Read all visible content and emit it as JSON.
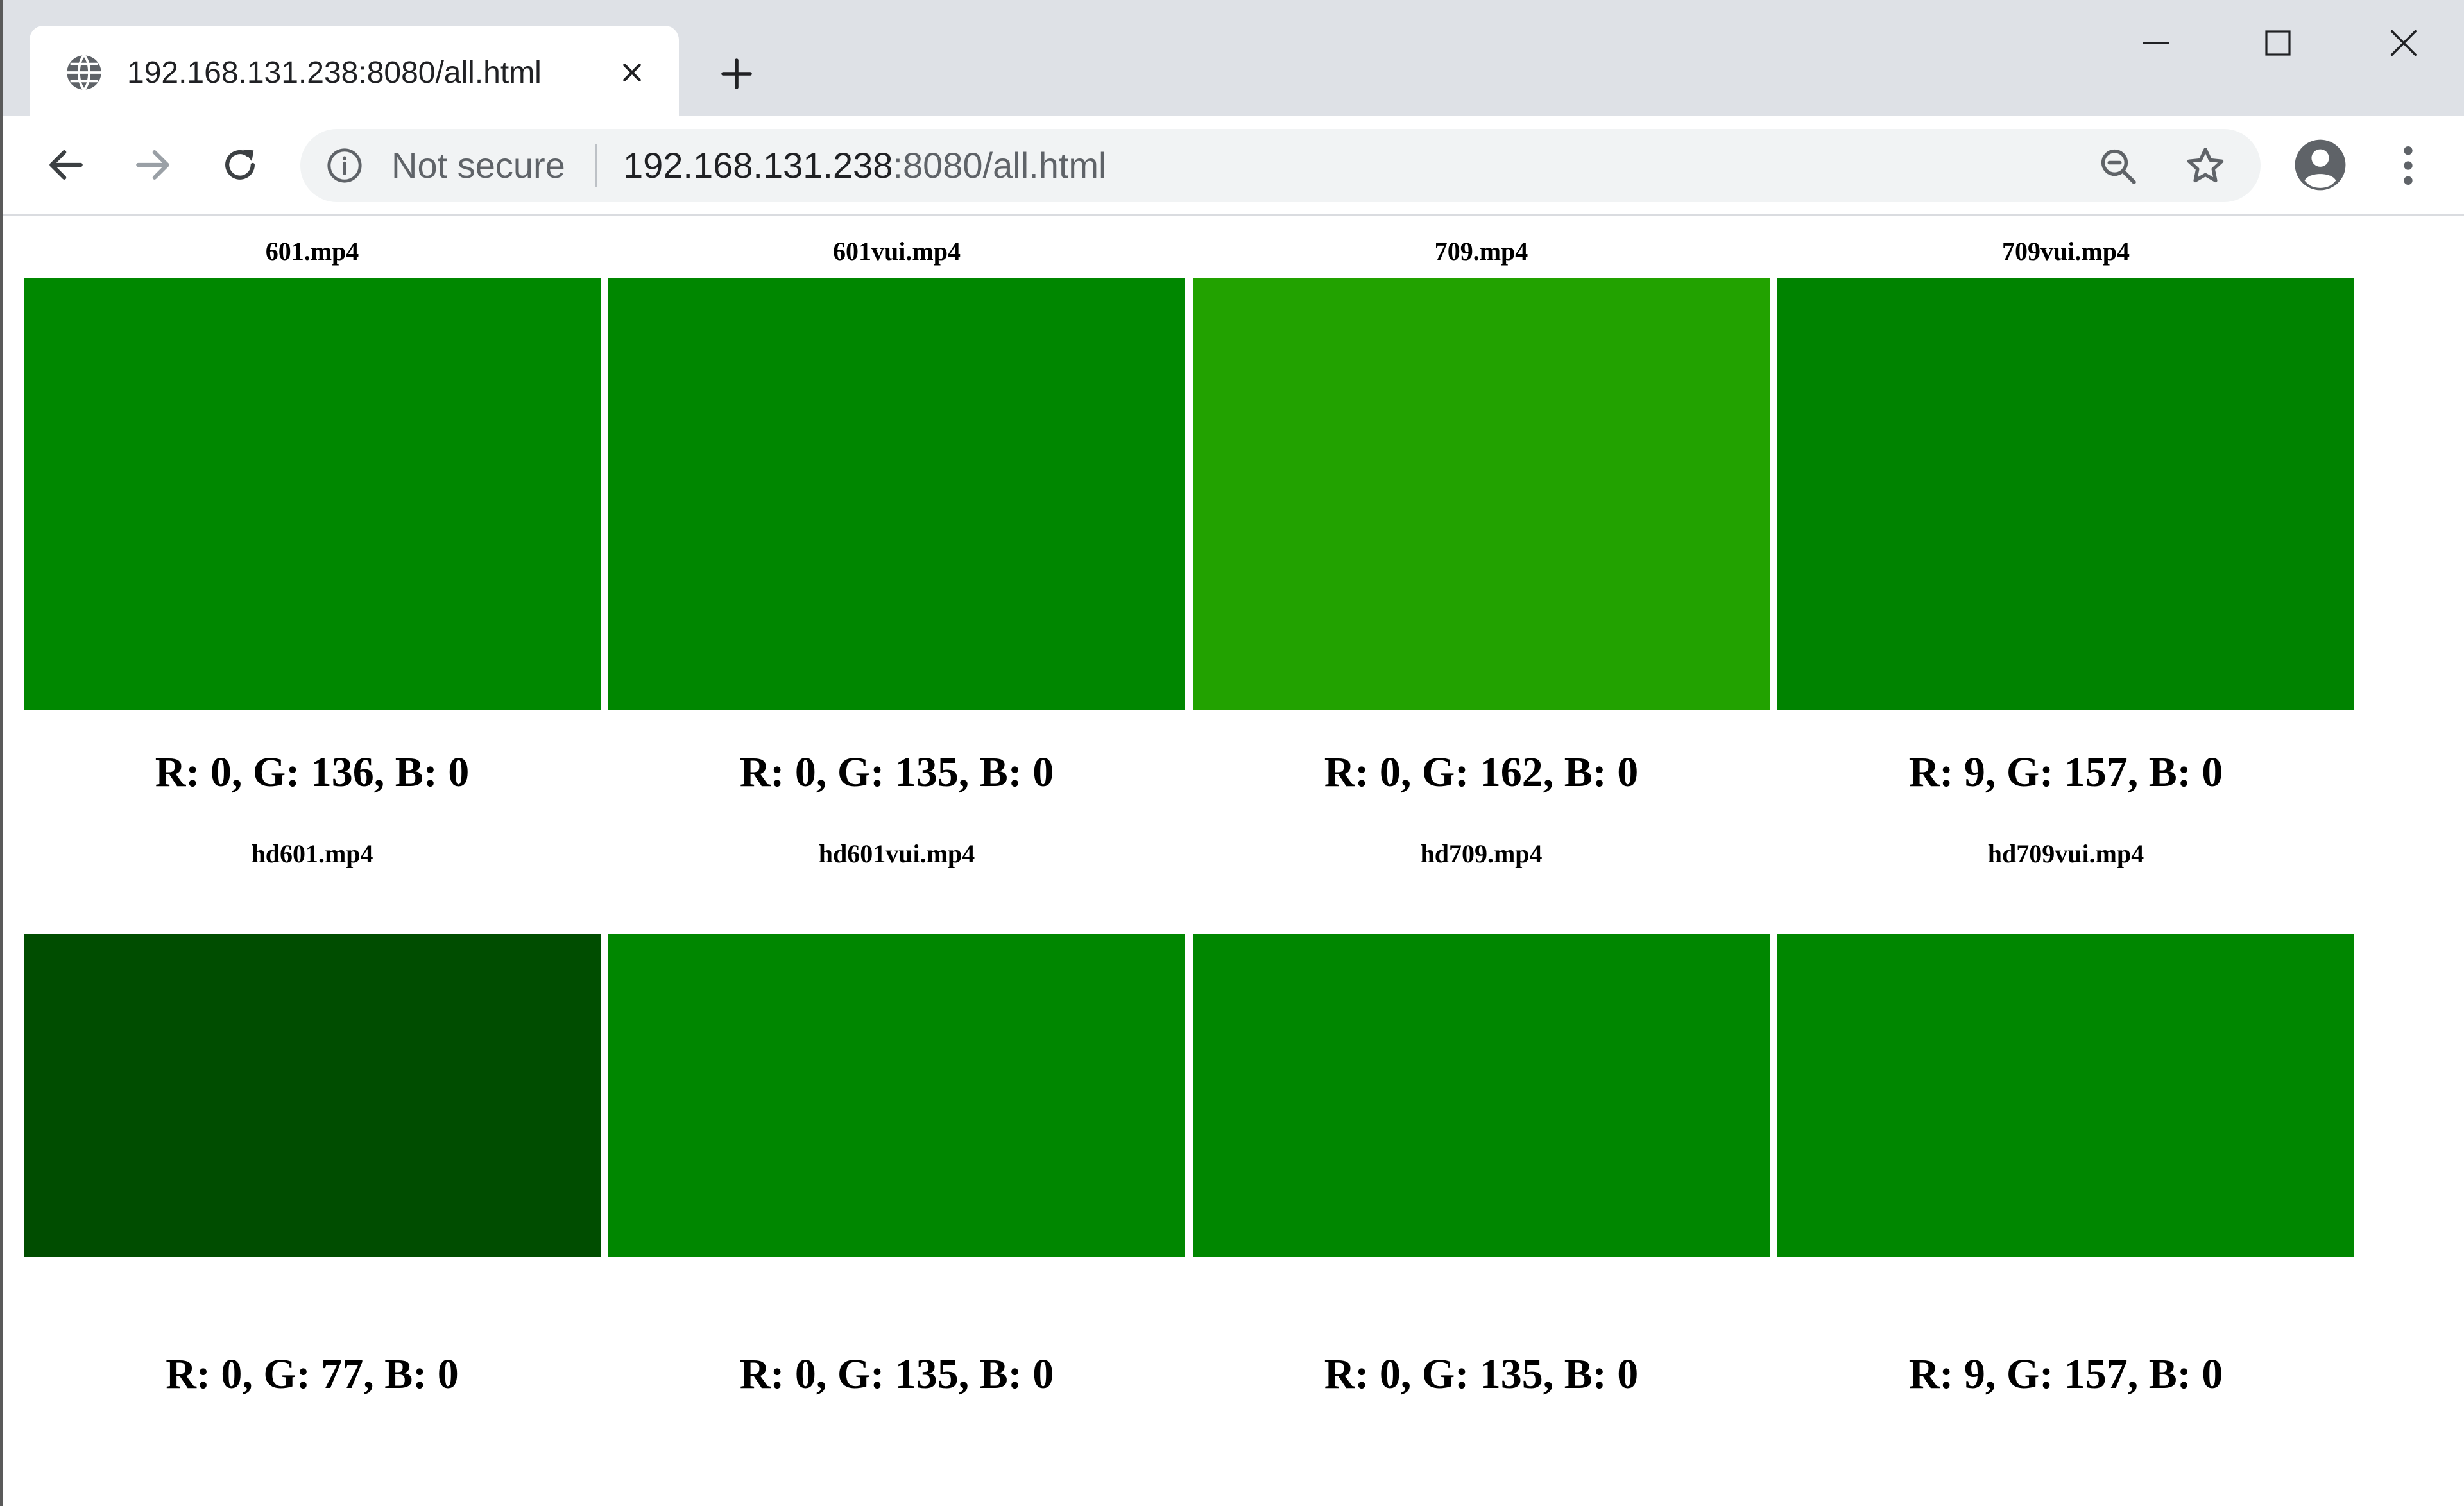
{
  "browser": {
    "tab": {
      "title": "192.168.131.238:8080/all.html",
      "favicon": "globe-icon",
      "close_icon": "close-icon"
    },
    "new_tab_icon": "plus-icon",
    "window_controls": [
      "minimize-icon",
      "maximize-icon",
      "close-icon"
    ],
    "toolbar": {
      "back_icon": "arrow-left-icon",
      "forward_icon": "arrow-right-icon",
      "reload_icon": "reload-icon",
      "security_label": "Not secure",
      "url_host": "192.168.131.238",
      "url_rest": ":8080/all.html",
      "zoom_icon": "zoom-out-icon",
      "bookmark_icon": "star-icon",
      "profile_icon": "account-icon",
      "menu_icon": "more-vert-icon"
    }
  },
  "page": {
    "videos": [
      {
        "file": "601.mp4",
        "color": "#008800",
        "rgb": "R: 0, G: 136, B: 0"
      },
      {
        "file": "601vui.mp4",
        "color": "#008700",
        "rgb": "R: 0, G: 135, B: 0"
      },
      {
        "file": "709.mp4",
        "color": "#22a200",
        "rgb": "R: 0, G: 162, B: 0"
      },
      {
        "file": "709vui.mp4",
        "color": "#008300",
        "rgb": "R: 9, G: 157, B: 0"
      },
      {
        "file": "hd601.mp4",
        "color": "#004d00",
        "rgb": "R: 0, G: 77, B: 0"
      },
      {
        "file": "hd601vui.mp4",
        "color": "#008700",
        "rgb": "R: 0, G: 135, B: 0"
      },
      {
        "file": "hd709.mp4",
        "color": "#008700",
        "rgb": "R: 0, G: 135, B: 0"
      },
      {
        "file": "hd709vui.mp4",
        "color": "#008700",
        "rgb": "R: 9, G: 157, B: 0"
      }
    ]
  }
}
